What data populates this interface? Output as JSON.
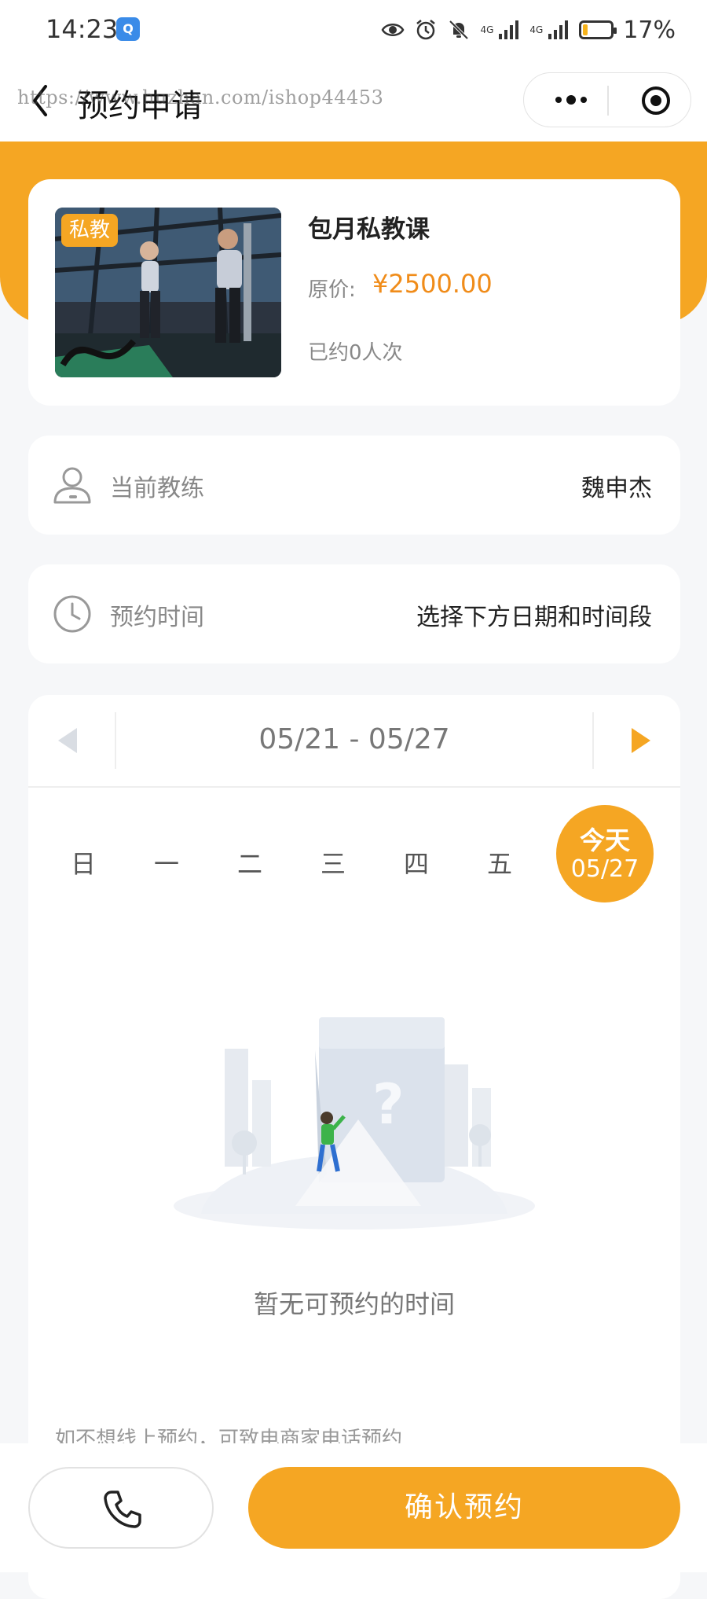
{
  "status_bar": {
    "time": "14:23",
    "app_badge": "Q",
    "signal_label_1": "4G",
    "signal_label_2": "4G",
    "battery_percent": 17,
    "battery_text": "17%"
  },
  "nav": {
    "title": "预约申请",
    "watermark": "https://www.huzhan.com/ishop44453"
  },
  "course": {
    "tag": "私教",
    "name": "包月私教课",
    "price_label": "原价:",
    "price": "¥2500.00",
    "booked": "已约0人次"
  },
  "coach_row": {
    "label": "当前教练",
    "value": "魏申杰"
  },
  "time_row": {
    "label": "预约时间",
    "value": "选择下方日期和时间段"
  },
  "calendar": {
    "range": "05/21 - 05/27",
    "days": [
      "日",
      "一",
      "二",
      "三",
      "四",
      "五"
    ],
    "today_label": "今天",
    "today_date": "05/27",
    "empty_text": "暂无可预约的时间",
    "offline_hint": "如不想线上预约，可致电商家电话预约"
  },
  "bottom": {
    "confirm_label": "确认预约"
  },
  "colors": {
    "accent": "#f5a623",
    "price": "#f08c1a"
  }
}
